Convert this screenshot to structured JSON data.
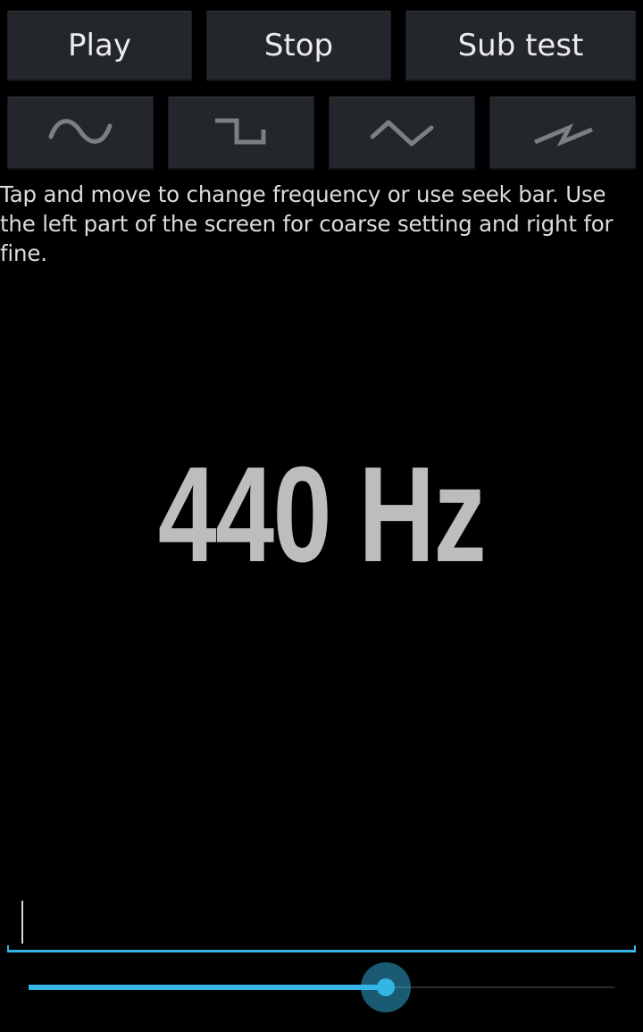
{
  "toolbar": {
    "play_label": "Play",
    "stop_label": "Stop",
    "subtest_label": "Sub test"
  },
  "waveforms": [
    {
      "name": "sine",
      "icon": "sine-wave-icon"
    },
    {
      "name": "square",
      "icon": "square-wave-icon"
    },
    {
      "name": "triangle",
      "icon": "triangle-wave-icon"
    },
    {
      "name": "sawtooth",
      "icon": "sawtooth-wave-icon"
    }
  ],
  "instructions": "Tap and move to change frequency or use seek bar. Use the left part of the screen for coarse setting and right for fine.",
  "frequency_display": "440 Hz",
  "frequency_input": {
    "value": ""
  },
  "seek_bar": {
    "progress": 0.61
  },
  "colors": {
    "background": "#000000",
    "button": "#23262b",
    "accent": "#33b5e5",
    "frequency_text": "#bdbdbd",
    "wave_icon": "#7b7e82"
  }
}
